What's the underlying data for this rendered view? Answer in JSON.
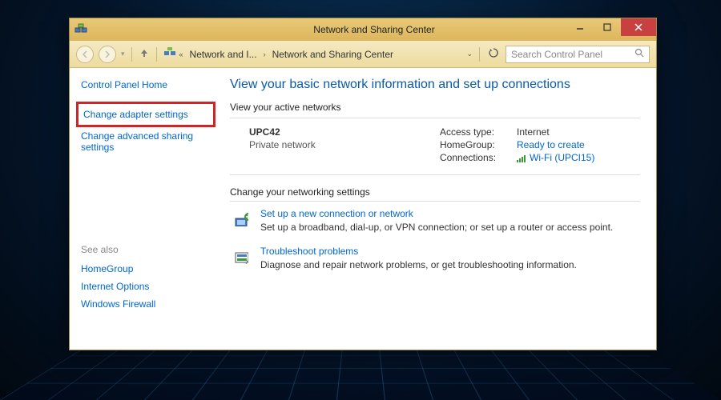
{
  "titlebar": {
    "title": "Network and Sharing Center"
  },
  "toolbar": {
    "crumb1": "Network and I...",
    "crumb2": "Network and Sharing Center",
    "search_placeholder": "Search Control Panel"
  },
  "sidebar": {
    "cp_home": "Control Panel Home",
    "adapter": "Change adapter settings",
    "advanced": "Change advanced sharing settings",
    "see_also_label": "See also",
    "see_also": {
      "homegroup": "HomeGroup",
      "iopts": "Internet Options",
      "firewall": "Windows Firewall"
    }
  },
  "main": {
    "heading": "View your basic network information and set up connections",
    "active_label": "View your active networks",
    "net": {
      "name": "UPC42",
      "type": "Private network",
      "access_label": "Access type:",
      "access_value": "Internet",
      "homegroup_label": "HomeGroup:",
      "homegroup_value": "Ready to create",
      "conn_label": "Connections:",
      "conn_value": "Wi-Fi (UPCI15)"
    },
    "change_label": "Change your networking settings",
    "opt1": {
      "title": "Set up a new connection or network",
      "desc": "Set up a broadband, dial-up, or VPN connection; or set up a router or access point."
    },
    "opt2": {
      "title": "Troubleshoot problems",
      "desc": "Diagnose and repair network problems, or get troubleshooting information."
    }
  }
}
